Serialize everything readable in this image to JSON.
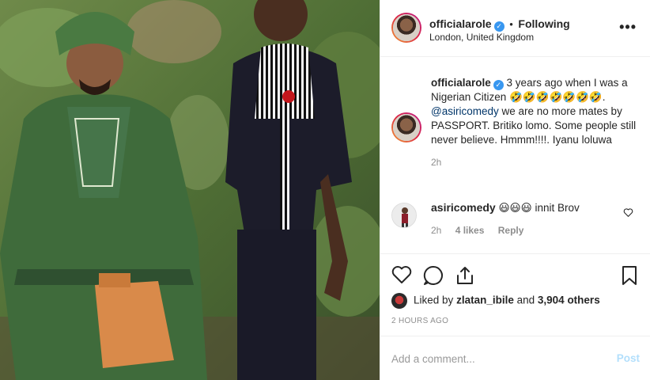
{
  "post": {
    "author": "officialarole",
    "follow_status": "Following",
    "separator": "•",
    "location": "London, United Kingdom",
    "more_label": "•••"
  },
  "caption": {
    "author": "officialarole",
    "text_before_mention": "3 years ago when I was a Nigerian Citizen 🤣🤣🤣🤣🤣🤣🤣.",
    "mention": "@asiricomedy",
    "text_after_mention": "we are no more mates by PASSPORT. Britiko lomo. Some people still never believe. Hmmm!!!!. Iyanu loluwa",
    "time": "2h"
  },
  "comment": {
    "author": "asiricomedy",
    "text": "😃😃😃 innit Brov",
    "time": "2h",
    "likes": "4 likes",
    "reply_label": "Reply"
  },
  "likes": {
    "prefix": "Liked by",
    "user": "zlatan_ibile",
    "connector": "and",
    "others": "3,904 others"
  },
  "timestamp": "2 HOURS AGO",
  "add_comment": {
    "placeholder": "Add a comment...",
    "post_label": "Post"
  },
  "icons": {
    "like": "heart-icon",
    "comment": "comment-icon",
    "share": "share-icon",
    "save": "bookmark-icon",
    "verified": "verified-badge-icon"
  },
  "colors": {
    "link": "#003569",
    "verified": "#3897f0",
    "muted": "#8e8e8e",
    "post_disabled": "#b2dffc"
  }
}
